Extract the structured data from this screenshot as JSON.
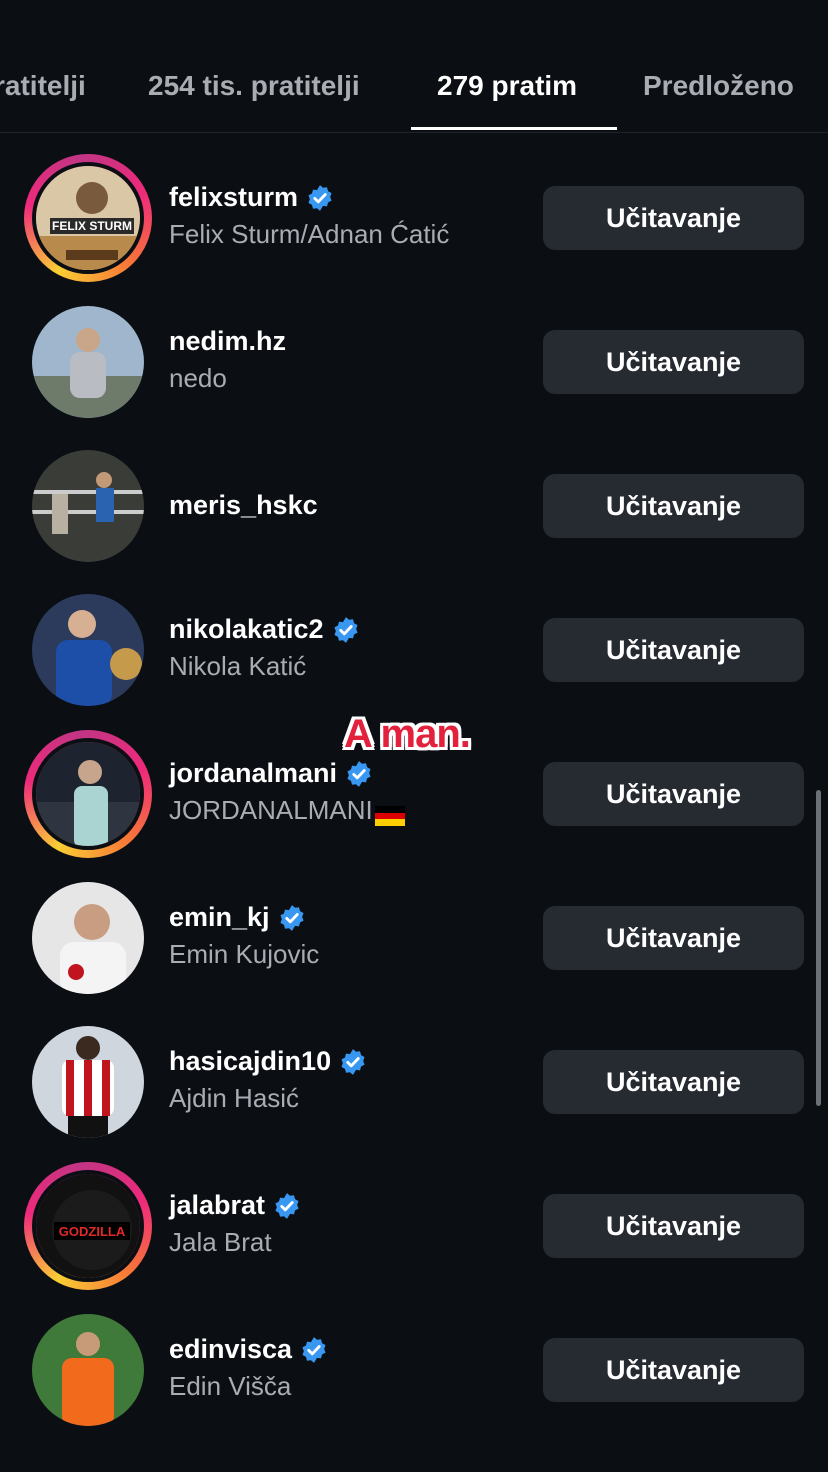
{
  "tabs": [
    {
      "label": "ratitelji"
    },
    {
      "label": "254 tis. pratitelji"
    },
    {
      "label": "279 pratim"
    },
    {
      "label": "Predloženo"
    }
  ],
  "overlay": {
    "text": "A man."
  },
  "button_label": "Učitavanje",
  "accounts": [
    {
      "username": "felixsturm",
      "full_name": "Felix Sturm/Adnan Ćatić",
      "verified": true,
      "ring": true
    },
    {
      "username": "nedim.hz",
      "full_name": "nedo",
      "verified": false,
      "ring": false
    },
    {
      "username": "meris_hskc",
      "full_name": "",
      "verified": false,
      "ring": false
    },
    {
      "username": "nikolakatic2",
      "full_name": "Nikola Katić",
      "verified": true,
      "ring": false
    },
    {
      "username": "jordanalmani",
      "full_name": "JORDANALMANI",
      "verified": true,
      "ring": true
    },
    {
      "username": "emin_kj",
      "full_name": "Emin Kujovic",
      "verified": true,
      "ring": false
    },
    {
      "username": "hasicajdin10",
      "full_name": "Ajdin Hasić",
      "verified": true,
      "ring": false
    },
    {
      "username": "jalabrat",
      "full_name": "Jala Brat",
      "verified": true,
      "ring": true
    },
    {
      "username": "edinvisca",
      "full_name": "Edin Višča",
      "verified": true,
      "ring": false
    }
  ],
  "colors": {
    "background": "#0b0f14",
    "button": "#262a31",
    "verified": "#3897f0",
    "secondary_text": "#a9adb3"
  }
}
